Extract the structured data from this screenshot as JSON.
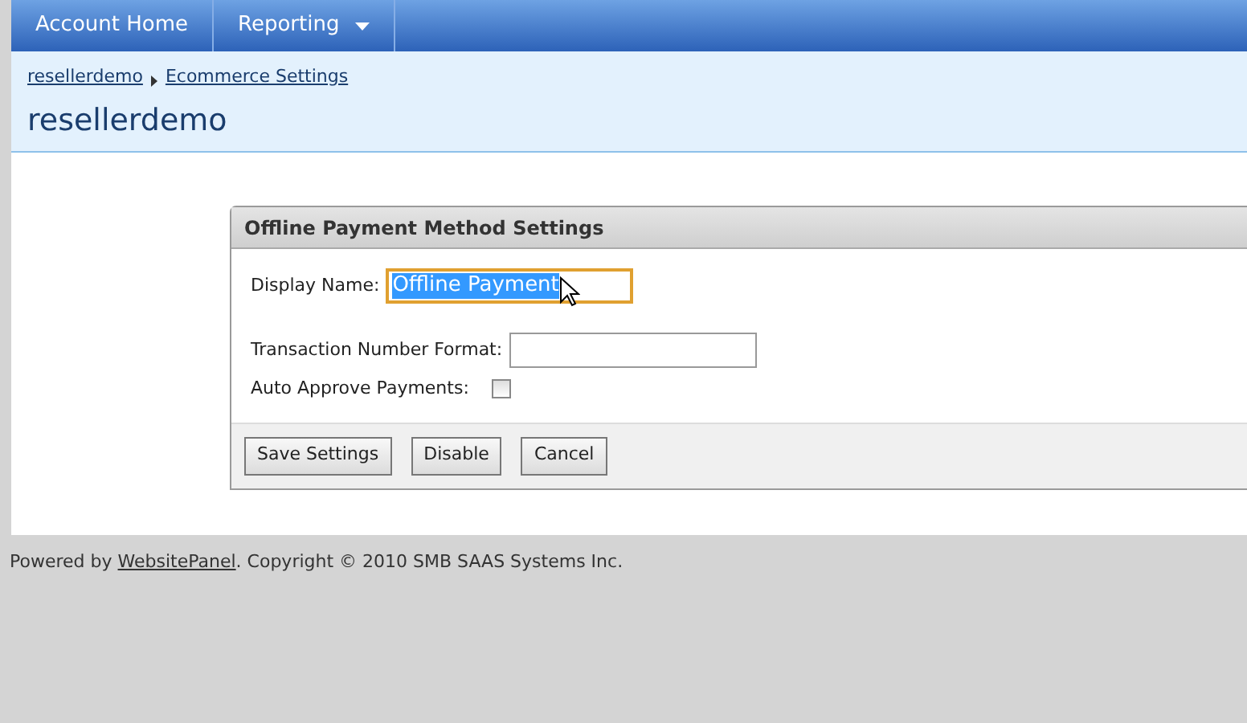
{
  "nav": [
    {
      "label": "Account Home",
      "dropdown": false
    },
    {
      "label": "Reporting",
      "dropdown": true
    }
  ],
  "breadcrumb": [
    "resellerdemo",
    "Ecommerce Settings"
  ],
  "page_title": "resellerdemo",
  "panel": {
    "title": "Offline Payment Method Settings",
    "fields": [
      {
        "kind": "text",
        "label": "Display Name:",
        "value": "Offline Payment",
        "focused": true,
        "text_selected": true
      },
      {
        "kind": "text",
        "label": "Transaction Number Format:",
        "focused": false
      },
      {
        "kind": "checkbox",
        "label": "Auto Approve Payments:",
        "checked": false
      }
    ],
    "buttons": [
      "Save Settings",
      "Disable",
      "Cancel"
    ]
  },
  "footer": {
    "prefix": "Powered by ",
    "link": "WebsitePanel",
    "suffix": ". Copyright © 2010 SMB SAAS Systems Inc."
  }
}
